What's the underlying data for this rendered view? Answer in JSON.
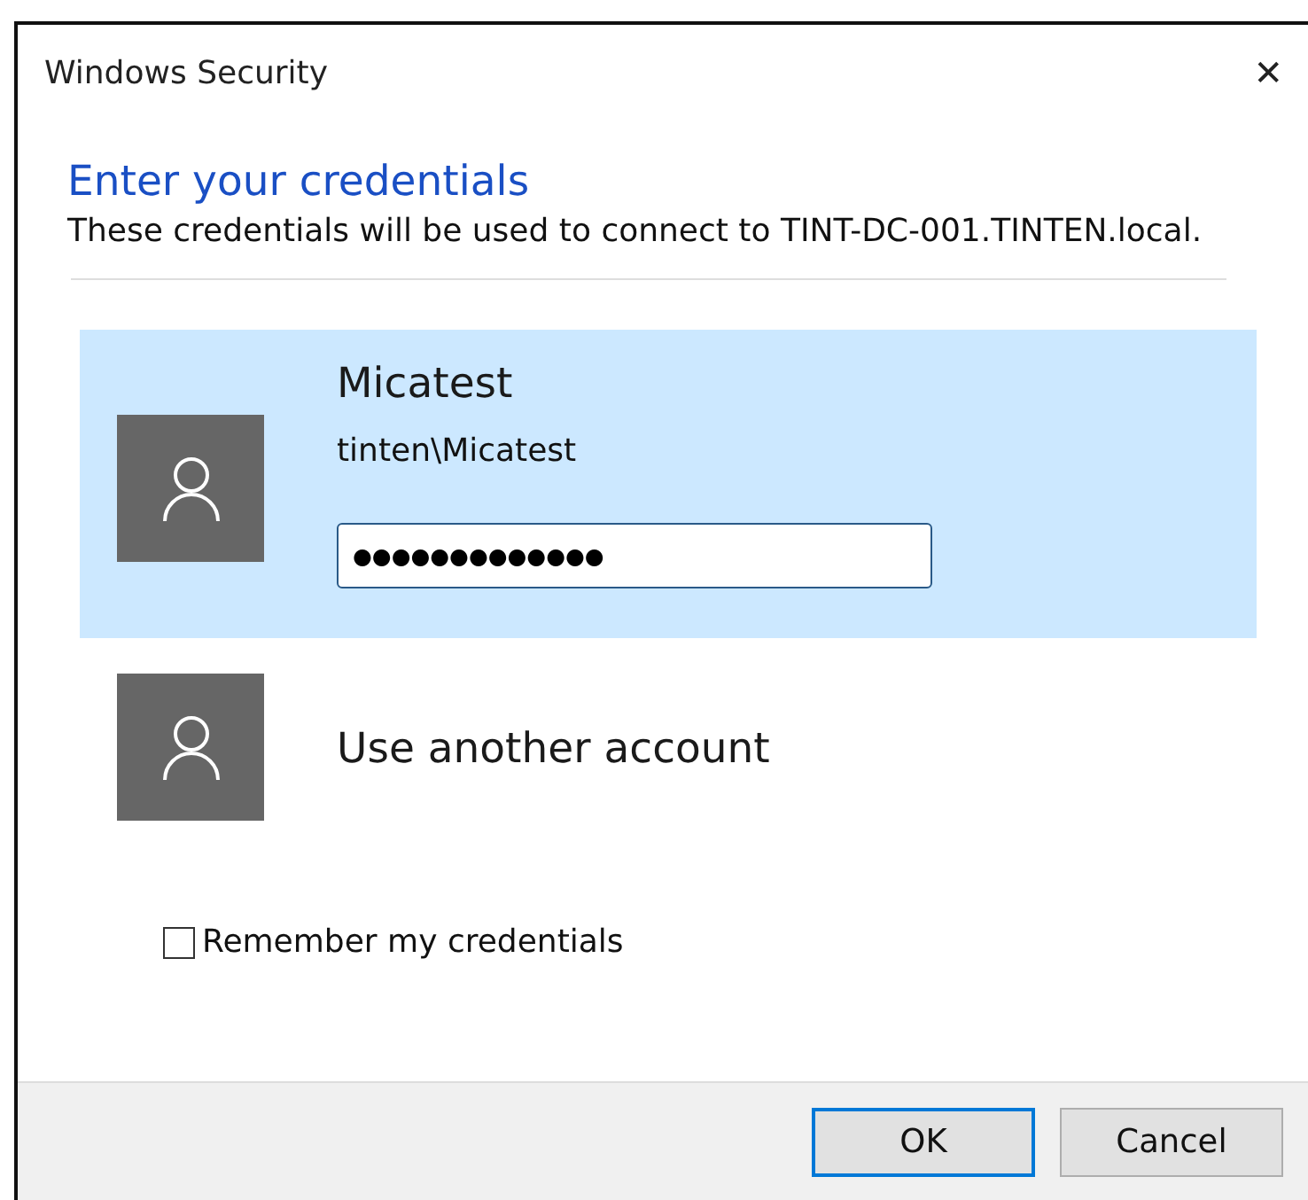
{
  "window": {
    "title": "Windows Security",
    "close": "✕"
  },
  "heading": "Enter your credentials",
  "description": "These credentials will be used to connect to TINT-DC-001.TINTEN.local.",
  "accounts": [
    {
      "name": "Micatest",
      "username": "tinten\\Micatest",
      "password": "●●●●●●●●●●●●●",
      "selected": true
    },
    {
      "name": "Use another account",
      "selected": false
    }
  ],
  "remember": {
    "label": "Remember my credentials",
    "checked": false
  },
  "buttons": [
    {
      "label": "OK",
      "default": true
    },
    {
      "label": "Cancel",
      "default": false
    }
  ]
}
